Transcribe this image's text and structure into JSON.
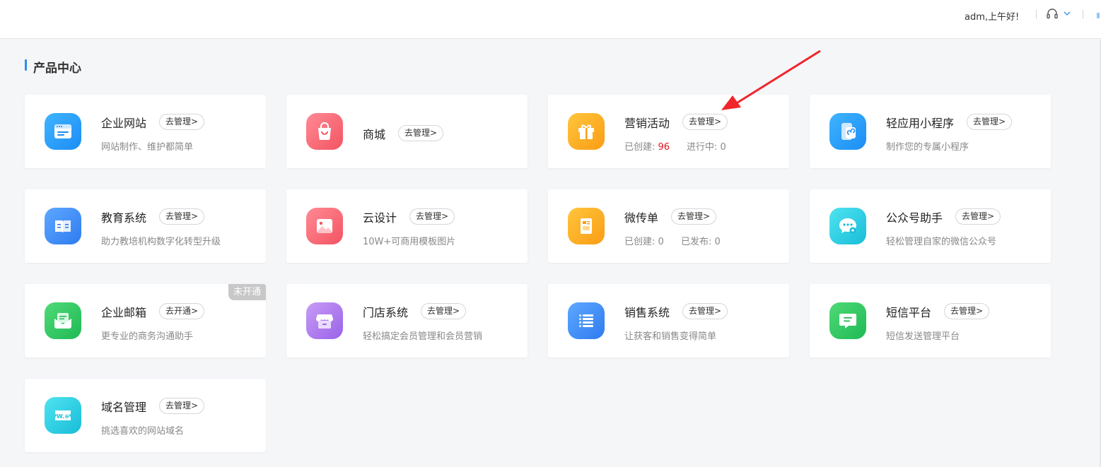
{
  "header": {
    "greeting": "adm,上午好!"
  },
  "section": {
    "title": "产品中心"
  },
  "colors": {
    "accent": "#2d8cf0",
    "highlight_red": "#e0141e"
  },
  "cards": [
    {
      "title": "企业网站",
      "button": "去管理>",
      "desc": "网站制作、维护都简单",
      "icon": "website-icon"
    },
    {
      "title": "商城",
      "button": "去管理>",
      "icon": "shopping-bag-icon"
    },
    {
      "title": "营销活动",
      "button": "去管理>",
      "icon": "gift-icon",
      "stats": [
        {
          "label": "已创建:",
          "value": "96"
        },
        {
          "label": "进行中:",
          "value": "0"
        }
      ]
    },
    {
      "title": "轻应用小程序",
      "button": "去管理>",
      "desc": "制作您的专属小程序",
      "icon": "mini-program-icon"
    },
    {
      "title": "教育系统",
      "button": "去管理>",
      "desc": "助力教培机构数字化转型升级",
      "icon": "book-icon"
    },
    {
      "title": "云设计",
      "button": "去管理>",
      "desc": "10W+可商用模板图片",
      "icon": "image-icon"
    },
    {
      "title": "微传单",
      "button": "去管理>",
      "icon": "flyer-icon",
      "stats": [
        {
          "label": "已创建:",
          "value": "0"
        },
        {
          "label": "已发布:",
          "value": "0"
        }
      ]
    },
    {
      "title": "公众号助手",
      "button": "去管理>",
      "desc": "轻松管理自家的微信公众号",
      "icon": "wechat-gear-icon"
    },
    {
      "title": "企业邮箱",
      "button": "去开通>",
      "desc": "更专业的商务沟通助手",
      "badge": "未开通",
      "icon": "mail-icon"
    },
    {
      "title": "门店系统",
      "button": "去管理>",
      "desc": "轻松搞定会员管理和会员营销",
      "icon": "store-icon"
    },
    {
      "title": "销售系统",
      "button": "去管理>",
      "desc": "让获客和销售变得简单",
      "icon": "list-icon"
    },
    {
      "title": "短信平台",
      "button": "去管理>",
      "desc": "短信发送管理平台",
      "icon": "sms-icon"
    },
    {
      "title": "域名管理",
      "button": "去管理>",
      "desc": "挑选喜欢的网站域名",
      "icon": "domain-icon"
    }
  ]
}
